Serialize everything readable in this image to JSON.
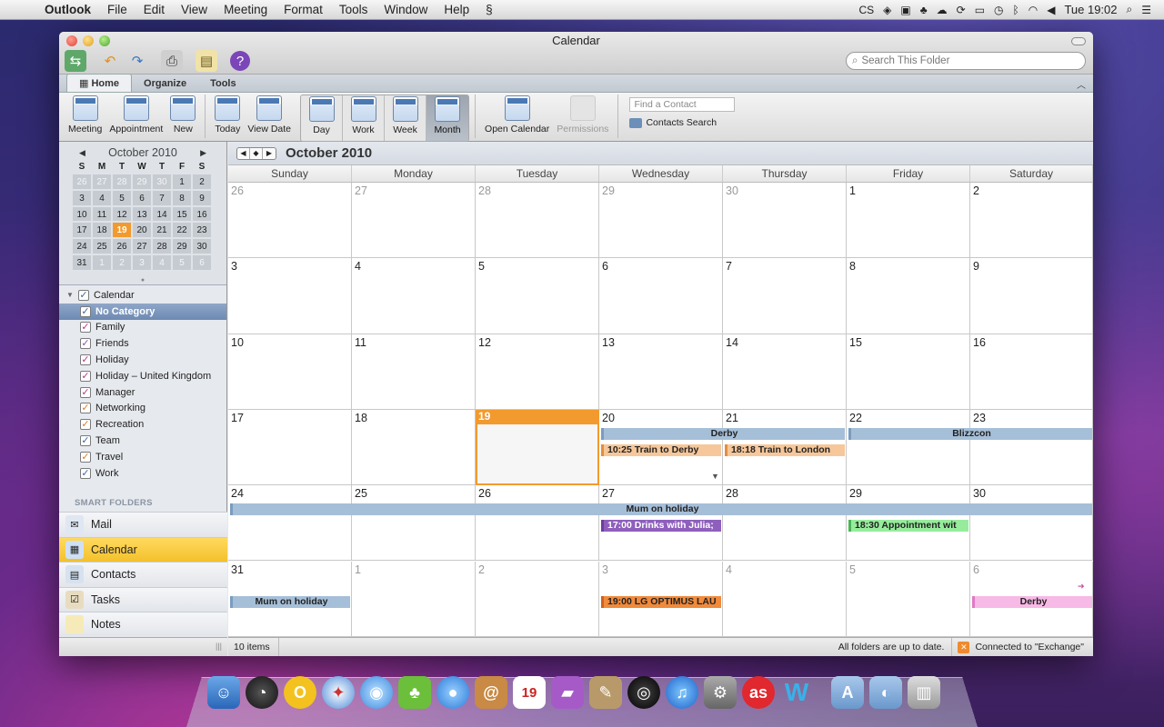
{
  "menubar": {
    "apple": "",
    "app": "Outlook",
    "items": [
      "File",
      "Edit",
      "View",
      "Meeting",
      "Format",
      "Tools",
      "Window",
      "Help"
    ],
    "status_cs": "CS",
    "clock": "Tue 19:02"
  },
  "window": {
    "title": "Calendar",
    "search_placeholder": "Search This Folder"
  },
  "ribbon_tabs": [
    "Home",
    "Organize",
    "Tools"
  ],
  "ribbon": {
    "meeting": "Meeting",
    "appointment": "Appointment",
    "new": "New",
    "today": "Today",
    "view_date": "View Date",
    "day": "Day",
    "work": "Work",
    "week": "Week",
    "month": "Month",
    "open_calendar": "Open Calendar",
    "permissions": "Permissions",
    "find_contact_placeholder": "Find a Contact",
    "contacts_search": "Contacts Search"
  },
  "mini_calendar": {
    "title": "October 2010",
    "dow": [
      "S",
      "M",
      "T",
      "W",
      "T",
      "F",
      "S"
    ],
    "days": [
      [
        "26",
        "27",
        "28",
        "29",
        "30",
        "1",
        "2"
      ],
      [
        "3",
        "4",
        "5",
        "6",
        "7",
        "8",
        "9"
      ],
      [
        "10",
        "11",
        "12",
        "13",
        "14",
        "15",
        "16"
      ],
      [
        "17",
        "18",
        "19",
        "20",
        "21",
        "22",
        "23"
      ],
      [
        "24",
        "25",
        "26",
        "27",
        "28",
        "29",
        "30"
      ],
      [
        "31",
        "1",
        "2",
        "3",
        "4",
        "5",
        "6"
      ]
    ],
    "today": "19"
  },
  "calendars": {
    "root": "Calendar",
    "categories": [
      {
        "label": "No Category",
        "color": "#ffffff",
        "selected": true
      },
      {
        "label": "Family",
        "color": "#c0338f"
      },
      {
        "label": "Friends",
        "color": "#8a4fb8"
      },
      {
        "label": "Holiday",
        "color": "#c0338f"
      },
      {
        "label": "Holiday – United Kingdom",
        "color": "#c0338f"
      },
      {
        "label": "Manager",
        "color": "#c0338f"
      },
      {
        "label": "Networking",
        "color": "#e07a1e"
      },
      {
        "label": "Recreation",
        "color": "#e07a1e"
      },
      {
        "label": "Team",
        "color": "#3b6aa8"
      },
      {
        "label": "Travel",
        "color": "#e07a1e"
      },
      {
        "label": "Work",
        "color": "#3b6aa8"
      }
    ],
    "smart_folders": "SMART FOLDERS"
  },
  "nav": [
    {
      "label": "Mail",
      "icon": "mail-icon",
      "active": false
    },
    {
      "label": "Calendar",
      "icon": "calendar-icon",
      "active": true
    },
    {
      "label": "Contacts",
      "icon": "contacts-icon",
      "active": false
    },
    {
      "label": "Tasks",
      "icon": "tasks-icon",
      "active": false
    },
    {
      "label": "Notes",
      "icon": "notes-icon",
      "active": false
    }
  ],
  "month_view": {
    "title": "October 2010",
    "weekdays": [
      "Sunday",
      "Monday",
      "Tuesday",
      "Wednesday",
      "Thursday",
      "Friday",
      "Saturday"
    ],
    "weeks": [
      [
        "26",
        "27",
        "28",
        "29",
        "30",
        "1",
        "2"
      ],
      [
        "3",
        "4",
        "5",
        "6",
        "7",
        "8",
        "9"
      ],
      [
        "10",
        "11",
        "12",
        "13",
        "14",
        "15",
        "16"
      ],
      [
        "17",
        "18",
        "19",
        "20",
        "21",
        "22",
        "23"
      ],
      [
        "24",
        "25",
        "26",
        "27",
        "28",
        "29",
        "30"
      ],
      [
        "31",
        "1",
        "2",
        "3",
        "4",
        "5",
        "6"
      ]
    ],
    "events": {
      "derby": "Derby",
      "blizzcon": "Blizzcon",
      "train_derby": "10:25 Train to Derby",
      "train_london": "18:18 Train to London",
      "mum_holiday": "Mum on holiday",
      "drinks": "17:00 Drinks with Julia;",
      "appointment": "18:30 Appointment wit",
      "mum_holiday_31": "Mum on holiday",
      "lg": "19:00 LG OPTIMUS LAU",
      "derby_6": "Derby"
    }
  },
  "status": {
    "items": "10 items",
    "folders": "All folders are up to date.",
    "connection": "Connected to \"Exchange\""
  }
}
